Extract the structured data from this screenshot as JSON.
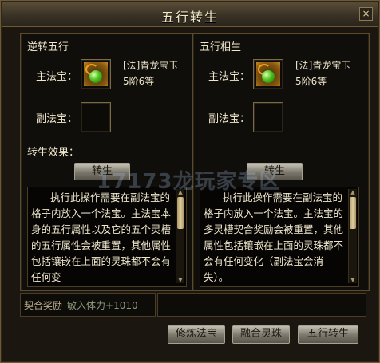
{
  "window": {
    "title": "五行转生",
    "close_glyph": "×"
  },
  "left_panel": {
    "title": "逆转五行",
    "main_label": "主法宝：",
    "main_item": {
      "name": "[法]青龙宝玉",
      "level": "5阶6等",
      "icon": "green-jade-icon"
    },
    "sub_label": "副法宝：",
    "effect_label": "转生效果：",
    "button": "转生",
    "description": "执行此操作需要在副法宝的格子内放入一个法宝。主法宝本身的五行属性以及它的五个灵槽的五行属性会被重置，其他属性包括镶嵌在上面的灵珠都不会有任何变"
  },
  "right_panel": {
    "title": "五行相生",
    "main_label": "主法宝：",
    "main_item": {
      "name": "[法]青龙宝玉",
      "level": "5阶6等",
      "icon": "green-jade-icon"
    },
    "sub_label": "副法宝：",
    "button": "转生",
    "description": "执行此操作需要在副法宝的格子内放入一个法宝。主法宝的多灵槽契合奖励会被重置，其他属性包括镶嵌在上面的灵珠都不会有任何变化（副法宝会消失）。"
  },
  "bottom": {
    "reward_label": "契合奖励",
    "reward_value": "敏入体力+1010",
    "buttons": [
      "修炼法宝",
      "融合灵珠",
      "五行转生"
    ]
  },
  "watermark": "17173龙玩家专区",
  "colors": {
    "frame": "#6d5a32",
    "text": "#efe6cc",
    "gem": "#4ec21e"
  }
}
